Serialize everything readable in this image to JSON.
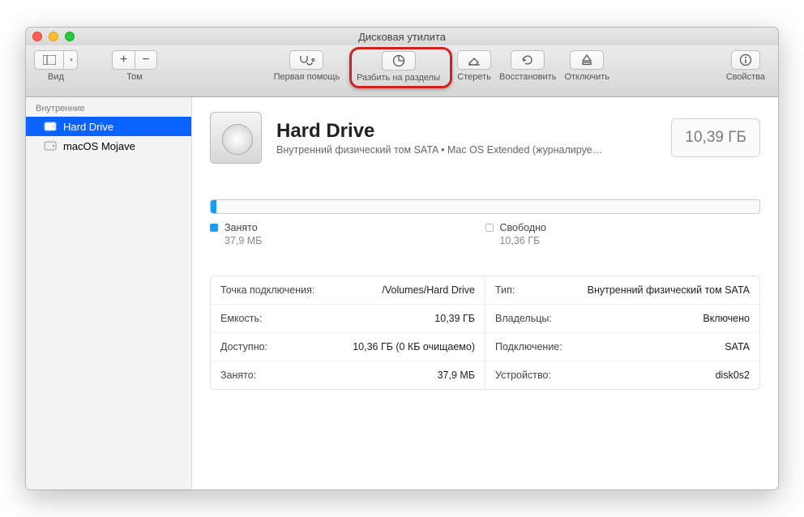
{
  "window": {
    "title": "Дисковая утилита"
  },
  "toolbar": {
    "view_label": "Вид",
    "volume_label": "Том",
    "first_aid_label": "Первая помощь",
    "partition_label": "Разбить на разделы",
    "erase_label": "Стереть",
    "restore_label": "Восстановить",
    "unmount_label": "Отключить",
    "info_label": "Свойства"
  },
  "sidebar": {
    "header": "Внутренние",
    "items": [
      {
        "label": "Hard Drive",
        "selected": true
      },
      {
        "label": "macOS Mojave",
        "selected": false
      }
    ]
  },
  "disk": {
    "name": "Hard Drive",
    "subtitle": "Внутренний физический том SATA • Mac OS Extended (журналируе…",
    "size": "10,39 ГБ"
  },
  "usage": {
    "used_label": "Занято",
    "used_value": "37,9 МБ",
    "free_label": "Свободно",
    "free_value": "10,36 ГБ"
  },
  "info": {
    "left": [
      {
        "k": "Точка подключения:",
        "v": "/Volumes/Hard Drive"
      },
      {
        "k": "Емкость:",
        "v": "10,39 ГБ"
      },
      {
        "k": "Доступно:",
        "v": "10,36 ГБ (0 КБ очищаемо)"
      },
      {
        "k": "Занято:",
        "v": "37,9 МБ"
      }
    ],
    "right": [
      {
        "k": "Тип:",
        "v": "Внутренний физический том SATA"
      },
      {
        "k": "Владельцы:",
        "v": "Включено"
      },
      {
        "k": "Подключение:",
        "v": "SATA"
      },
      {
        "k": "Устройство:",
        "v": "disk0s2"
      }
    ]
  }
}
